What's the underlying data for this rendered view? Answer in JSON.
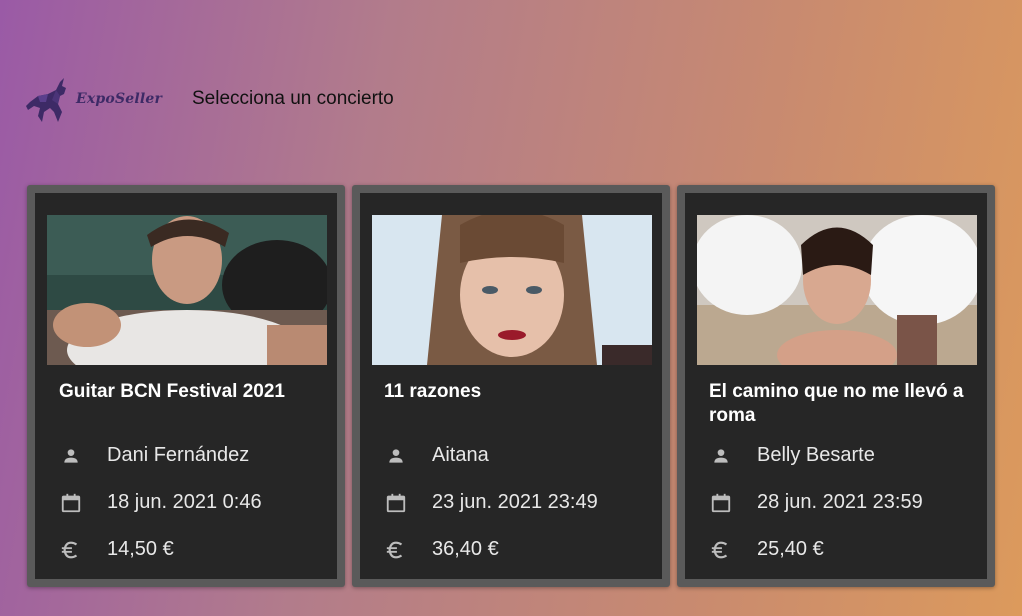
{
  "header": {
    "logo_text": "ExpoSeller",
    "title": "Selecciona un concierto"
  },
  "icons": {
    "artist": "person-icon",
    "date": "calendar-icon",
    "price": "euro-icon"
  },
  "concerts": [
    {
      "title": "Guitar BCN Festival 2021",
      "artist": "Dani Fernández",
      "date": "18 jun. 2021 0:46",
      "price": "14,50 €"
    },
    {
      "title": "11 razones",
      "artist": "Aitana",
      "date": "23 jun. 2021 23:49",
      "price": "36,40 €"
    },
    {
      "title": "El camino que no me llevó a roma",
      "artist": "Belly Besarte",
      "date": "28 jun. 2021 23:59",
      "price": "25,40 €"
    }
  ],
  "colors": {
    "card_frame": "#5a5a5a",
    "card_body": "#262626",
    "text_primary": "#ffffff",
    "text_secondary": "#e8e8e8",
    "icon": "#bdbdbd"
  }
}
